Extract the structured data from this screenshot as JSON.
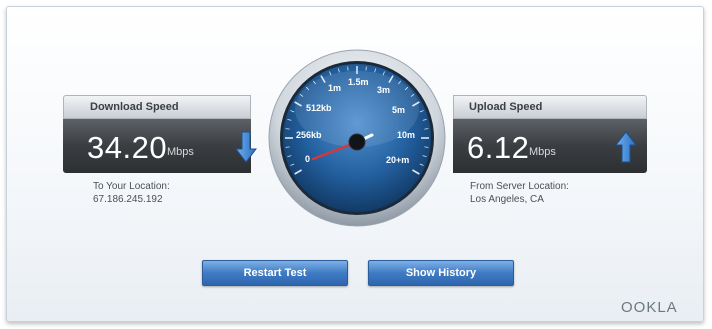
{
  "download": {
    "title": "Download Speed",
    "value": "34.20",
    "unit": "Mbps",
    "location_label": "To Your Location:",
    "location_value": "67.186.245.192",
    "arrow_icon": "arrow-down-icon"
  },
  "upload": {
    "title": "Upload Speed",
    "value": "6.12",
    "unit": "Mbps",
    "location_label": "From Server Location:",
    "location_value": "Los Angeles, CA",
    "arrow_icon": "arrow-up-icon"
  },
  "gauge": {
    "labels": [
      "0",
      "256kb",
      "512kb",
      "1m",
      "1.5m",
      "3m",
      "5m",
      "10m",
      "20+m"
    ]
  },
  "buttons": {
    "restart": "Restart Test",
    "history": "Show History"
  },
  "brand": "OOKLA",
  "colors": {
    "accent_blue": "#3f7bc4",
    "gauge_blue": "#1f5fa3",
    "needle_red": "#d6383a",
    "panel_dark": "#3a3d41"
  }
}
